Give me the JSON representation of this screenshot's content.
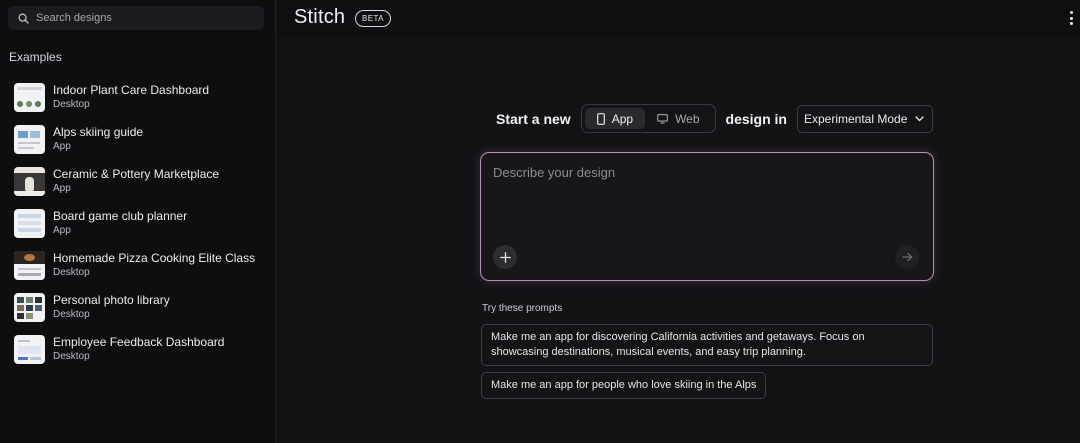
{
  "sidebar": {
    "search_placeholder": "Search designs",
    "examples_heading": "Examples",
    "items": [
      {
        "title": "Indoor Plant Care Dashboard",
        "type": "Desktop"
      },
      {
        "title": "Alps skiing guide",
        "type": "App"
      },
      {
        "title": "Ceramic & Pottery Marketplace",
        "type": "App"
      },
      {
        "title": "Board game club planner",
        "type": "App"
      },
      {
        "title": "Homemade Pizza Cooking Elite Class",
        "type": "Desktop"
      },
      {
        "title": "Personal photo library",
        "type": "Desktop"
      },
      {
        "title": "Employee Feedback Dashboard",
        "type": "Desktop"
      }
    ]
  },
  "header": {
    "title": "Stitch",
    "badge": "BETA",
    "menu_icon": "kebab-menu-icon"
  },
  "main": {
    "start_label": "Start a new",
    "toggle": [
      {
        "label": "App",
        "icon": "phone-icon",
        "active": true
      },
      {
        "label": "Web",
        "icon": "monitor-icon",
        "active": false
      }
    ],
    "design_in_label": "design in",
    "mode": "Experimental Mode",
    "prompt_placeholder": "Describe your design",
    "try_label": "Try these prompts",
    "prompts": [
      "Make me an app for discovering California activities and getaways. Focus on showcasing destinations, musical events, and easy trip planning.",
      "Make me an app for people who love skiing in the Alps"
    ]
  },
  "colors": {
    "background": "#131215",
    "sidebar": "#0e0d0f",
    "accent_border": "#b98fb8"
  }
}
